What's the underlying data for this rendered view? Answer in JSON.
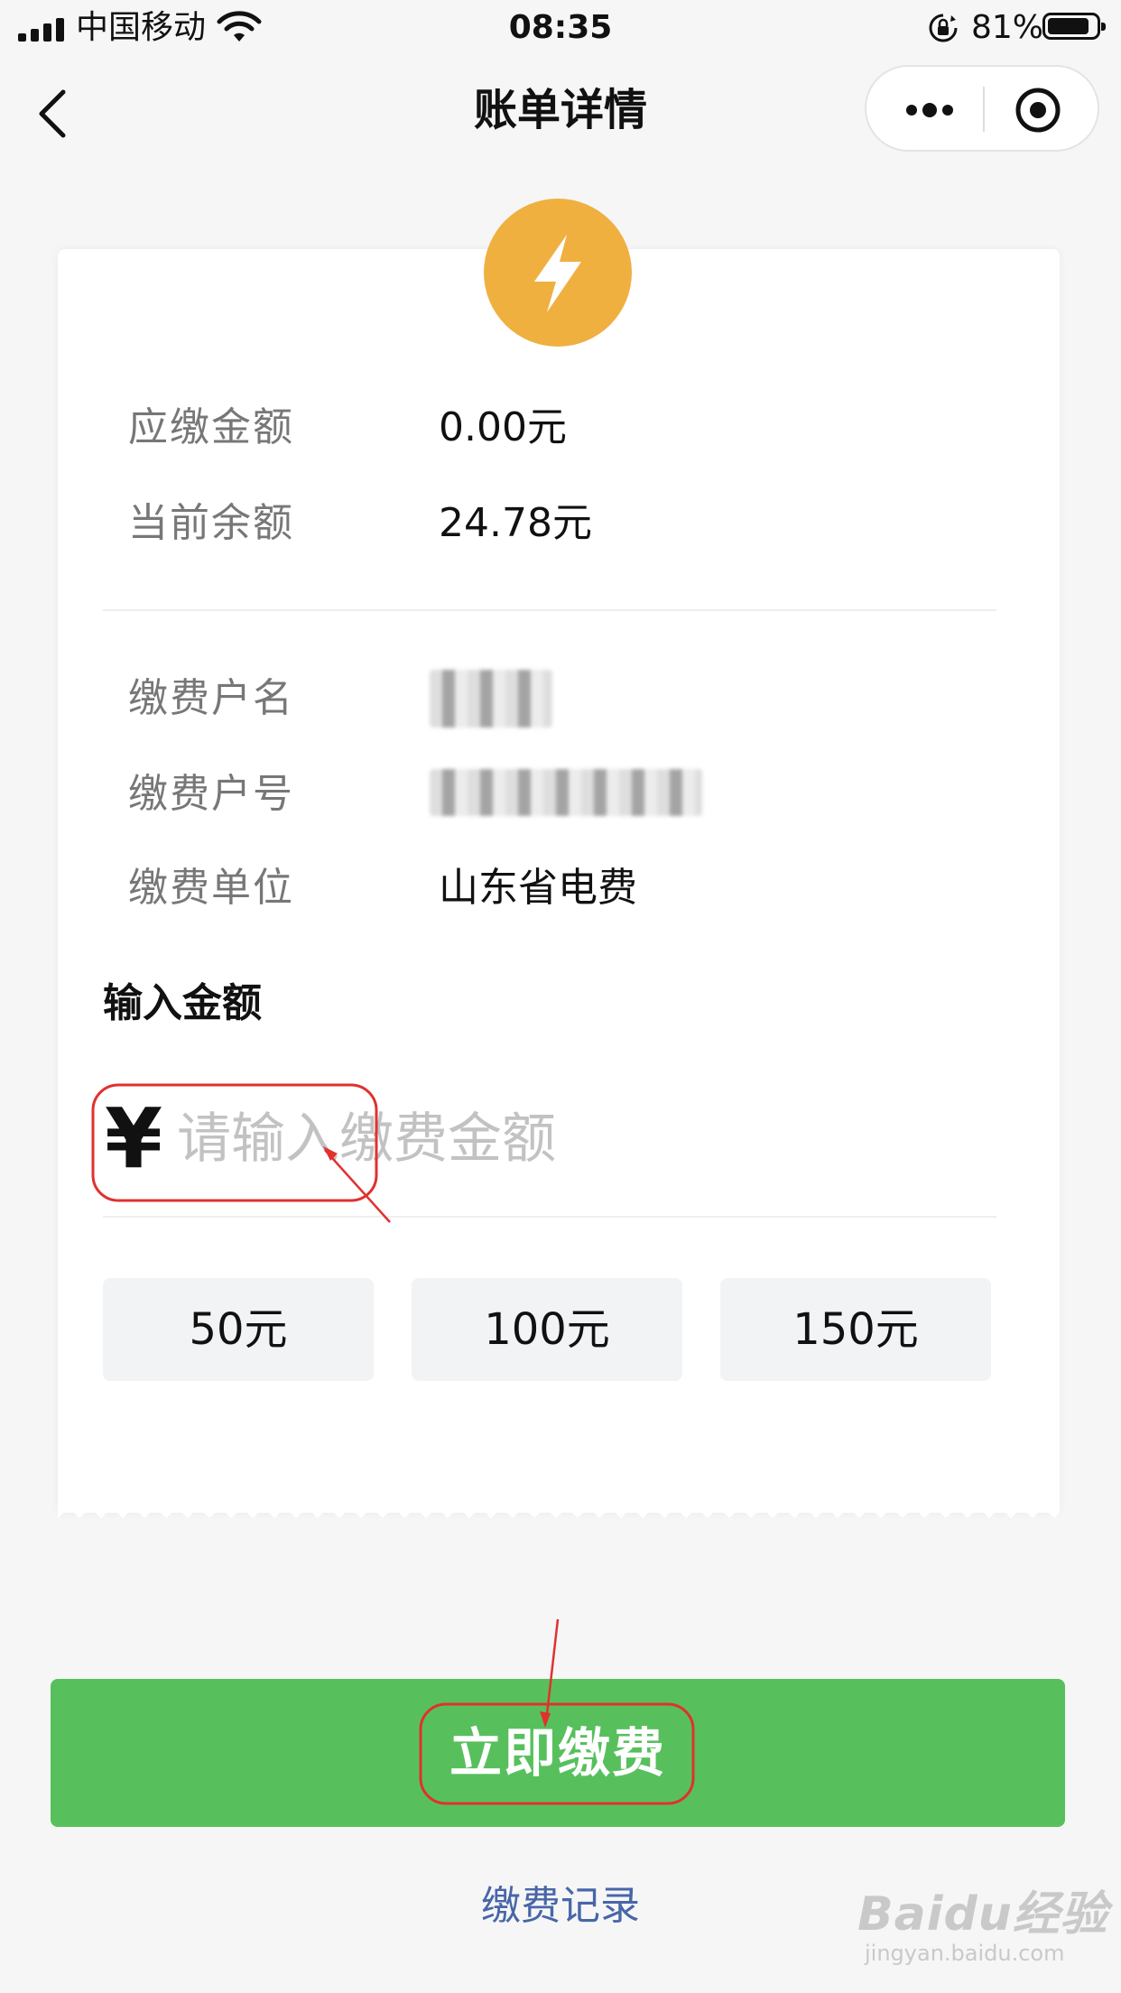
{
  "status_bar": {
    "carrier": "中国移动",
    "time": "08:35",
    "battery_percent": "81%",
    "battery_level": 0.81,
    "icons": [
      "signal-icon",
      "wifi-icon",
      "orientation-lock-icon",
      "battery-icon"
    ]
  },
  "nav": {
    "title": "账单详情",
    "icons": [
      "back-icon",
      "more-icon",
      "mini-program-record-icon"
    ]
  },
  "bill": {
    "icon": "lightning-bolt-icon",
    "brand_color": "#efb040",
    "rows": [
      {
        "label": "应缴金额",
        "value": "0.00元"
      },
      {
        "label": "当前余额",
        "value": "24.78元"
      }
    ]
  },
  "account": {
    "rows": [
      {
        "label": "缴费户名",
        "value": ""
      },
      {
        "label": "缴费户号",
        "value": ""
      },
      {
        "label": "缴费单位",
        "value": "山东省电费"
      }
    ]
  },
  "amount": {
    "section_label": "输入金额",
    "currency_symbol": "¥",
    "placeholder": "请输入缴费金额",
    "value": ""
  },
  "presets": [
    "50元",
    "100元",
    "150元"
  ],
  "actions": {
    "pay_label": "立即缴费",
    "pay_color": "#57c05d",
    "history_label": "缴费记录"
  },
  "watermark": {
    "main": "Baidu经验",
    "sub": "jingyan.baidu.com"
  }
}
